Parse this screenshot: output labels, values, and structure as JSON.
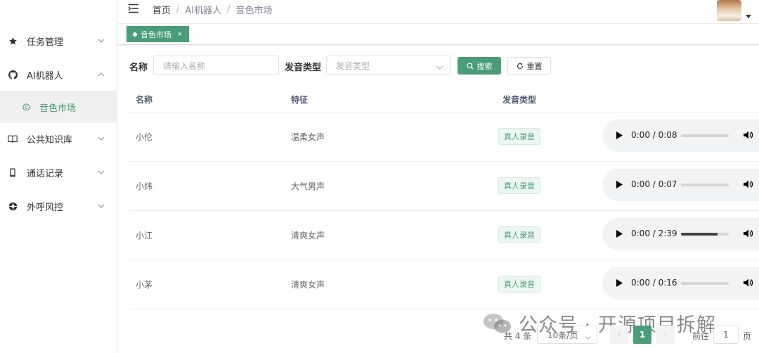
{
  "sidebar": {
    "items": [
      {
        "label": "任务管理",
        "icon": "star-icon",
        "expanded": false
      },
      {
        "label": "AI机器人",
        "icon": "github-icon",
        "expanded": true
      },
      {
        "label": "音色市场",
        "icon": "copyright-icon",
        "active": true
      },
      {
        "label": "公共知识库",
        "icon": "book-open-icon",
        "expanded": false
      },
      {
        "label": "通话记录",
        "icon": "mobile-phone-icon",
        "expanded": false
      },
      {
        "label": "外呼风控",
        "icon": "aperture-icon",
        "expanded": false
      }
    ]
  },
  "header": {
    "breadcrumb": [
      "首页",
      "AI机器人",
      "音色市场"
    ],
    "separator": "/"
  },
  "tags": {
    "active": {
      "label": "音色市场",
      "close": "×"
    }
  },
  "search": {
    "name_label": "名称",
    "name_placeholder": "请输入名称",
    "type_label": "发音类型",
    "type_placeholder": "发音类型",
    "search_button": "搜索",
    "reset_button": "重置"
  },
  "table": {
    "columns": [
      "名称",
      "特征",
      "发音类型"
    ],
    "rows": [
      {
        "name": "小伦",
        "feature": "温柔女声",
        "type": "真人录音",
        "time": "0:00 / 0:08",
        "progress": 0
      },
      {
        "name": "小炜",
        "feature": "大气男声",
        "type": "真人录音",
        "time": "0:00 / 0:07",
        "progress": 0
      },
      {
        "name": "小江",
        "feature": "清爽女声",
        "type": "真人录音",
        "time": "0:00 / 2:39",
        "progress": 0.77
      },
      {
        "name": "小茅",
        "feature": "清爽女声",
        "type": "真人录音",
        "time": "0:00 / 0:16",
        "progress": 0
      }
    ]
  },
  "pagination": {
    "total": "共 4 条",
    "page_size": "10条/页",
    "current_page": "1",
    "goto_prefix": "前往",
    "goto_value": "1",
    "goto_suffix": "页",
    "prev": "‹",
    "next": "›"
  },
  "watermark": {
    "text": "公众号 · 开源项目拆解"
  },
  "colors": {
    "accent": "#4a9d78",
    "badge_bg": "#edf6f1",
    "border": "#dcdfe6"
  }
}
